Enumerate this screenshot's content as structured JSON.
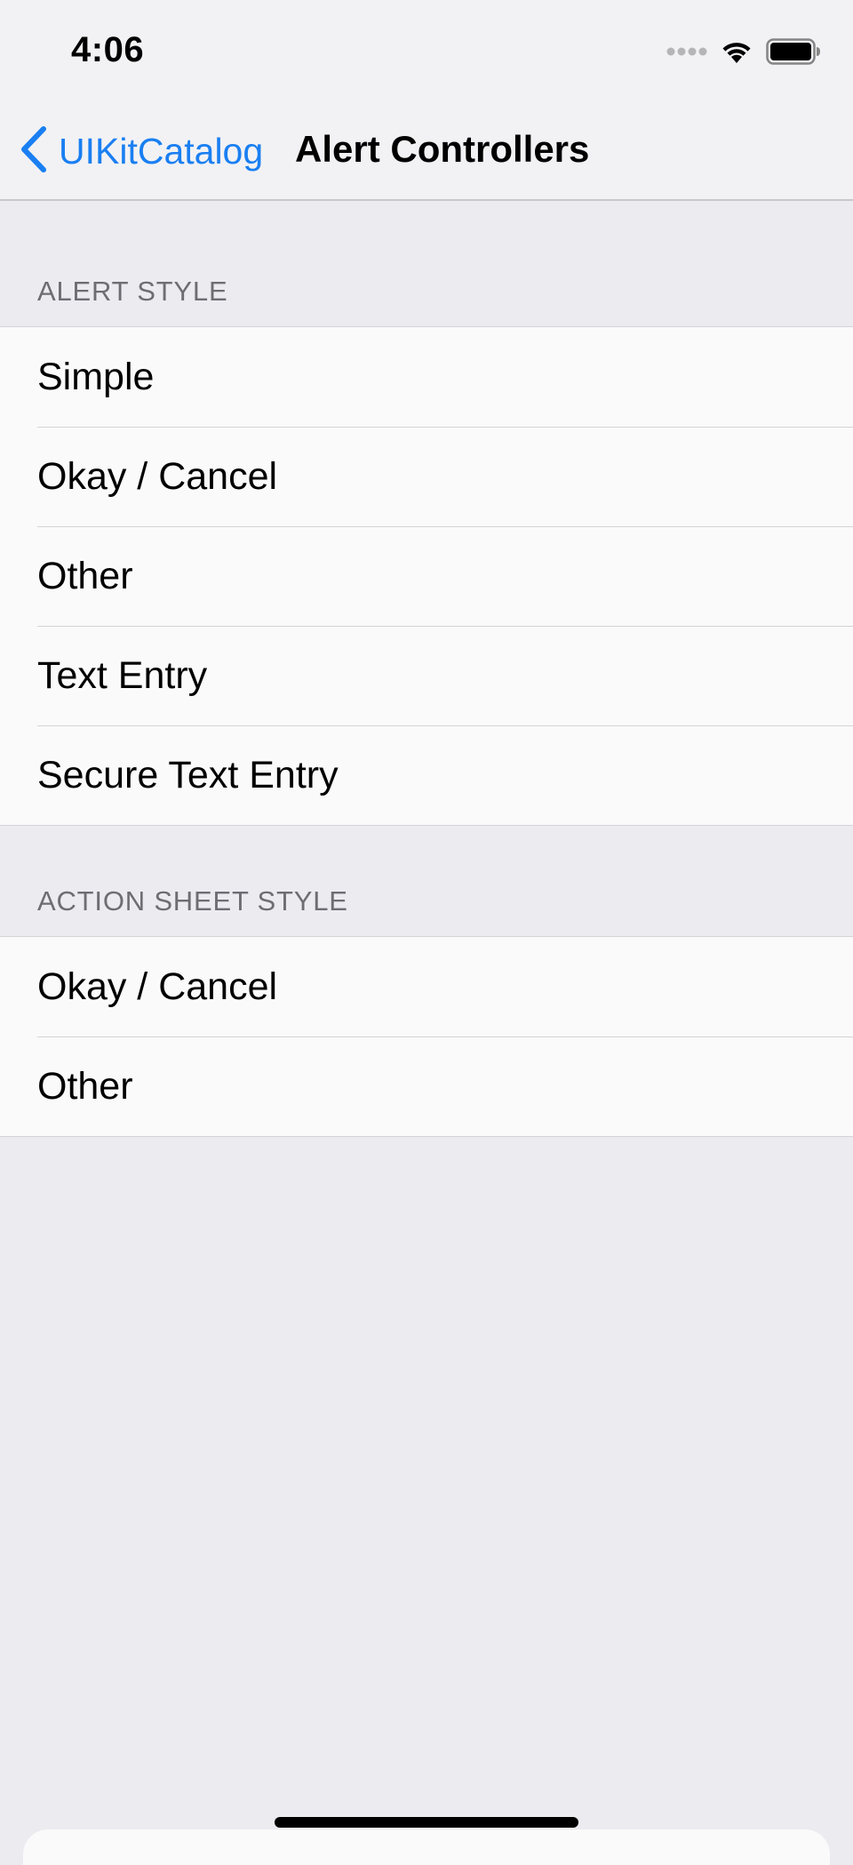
{
  "status_bar": {
    "time": "4:06",
    "icons": [
      "signal-dots-icon",
      "wifi-icon",
      "battery-icon"
    ]
  },
  "nav": {
    "back_label": "UIKitCatalog",
    "title": "Alert Controllers"
  },
  "sections": [
    {
      "header": "ALERT STYLE",
      "rows": [
        "Simple",
        "Okay / Cancel",
        "Other",
        "Text Entry",
        "Secure Text Entry"
      ]
    },
    {
      "header": "ACTION SHEET STYLE",
      "rows": [
        "Okay / Cancel",
        "Other"
      ]
    }
  ],
  "colors": {
    "tint": "#1a7ff2",
    "background": "#ebebf0",
    "cell": "#fafafa",
    "header_text": "#6d6d72"
  }
}
